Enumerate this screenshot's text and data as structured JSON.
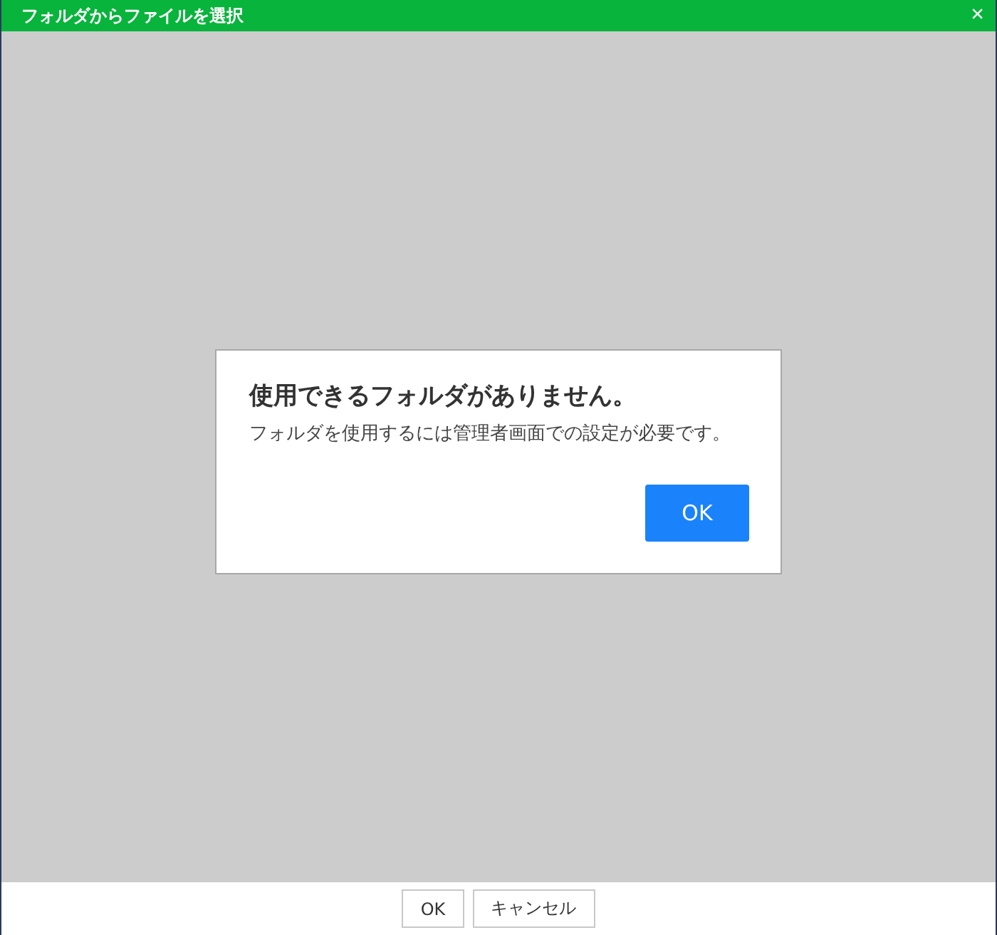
{
  "window": {
    "title": "フォルダからファイルを選択",
    "close": "×"
  },
  "alert": {
    "title": "使用できるフォルダがありません。",
    "message": "フォルダを使用するには管理者画面での設定が必要です。",
    "button": "OK"
  },
  "buttons": [
    "OK",
    "キャンセル"
  ]
}
